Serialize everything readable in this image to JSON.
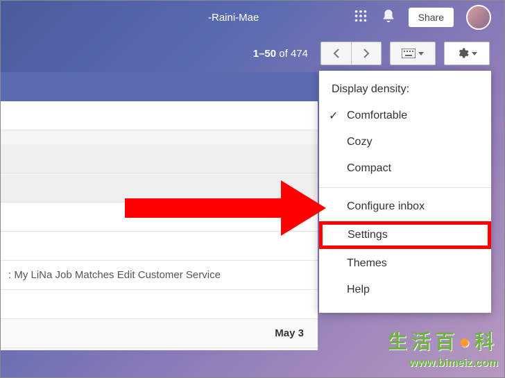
{
  "topbar": {
    "name_snippet": "-Raini-Mae",
    "share_label": "Share"
  },
  "toolbar": {
    "page_range": "1–50",
    "page_of": "of",
    "page_total": "474"
  },
  "dropdown": {
    "header": "Display density:",
    "comfortable": "Comfortable",
    "cozy": "Cozy",
    "compact": "Compact",
    "configure_inbox": "Configure inbox",
    "settings": "Settings",
    "themes": "Themes",
    "help": "Help"
  },
  "mail": {
    "snippet": ": My LiNa Job Matches Edit Customer Service",
    "date": "May 3"
  },
  "watermark": {
    "line1_a": "生活百",
    "line1_b": "科",
    "line2": "www.bimeiz.com"
  }
}
